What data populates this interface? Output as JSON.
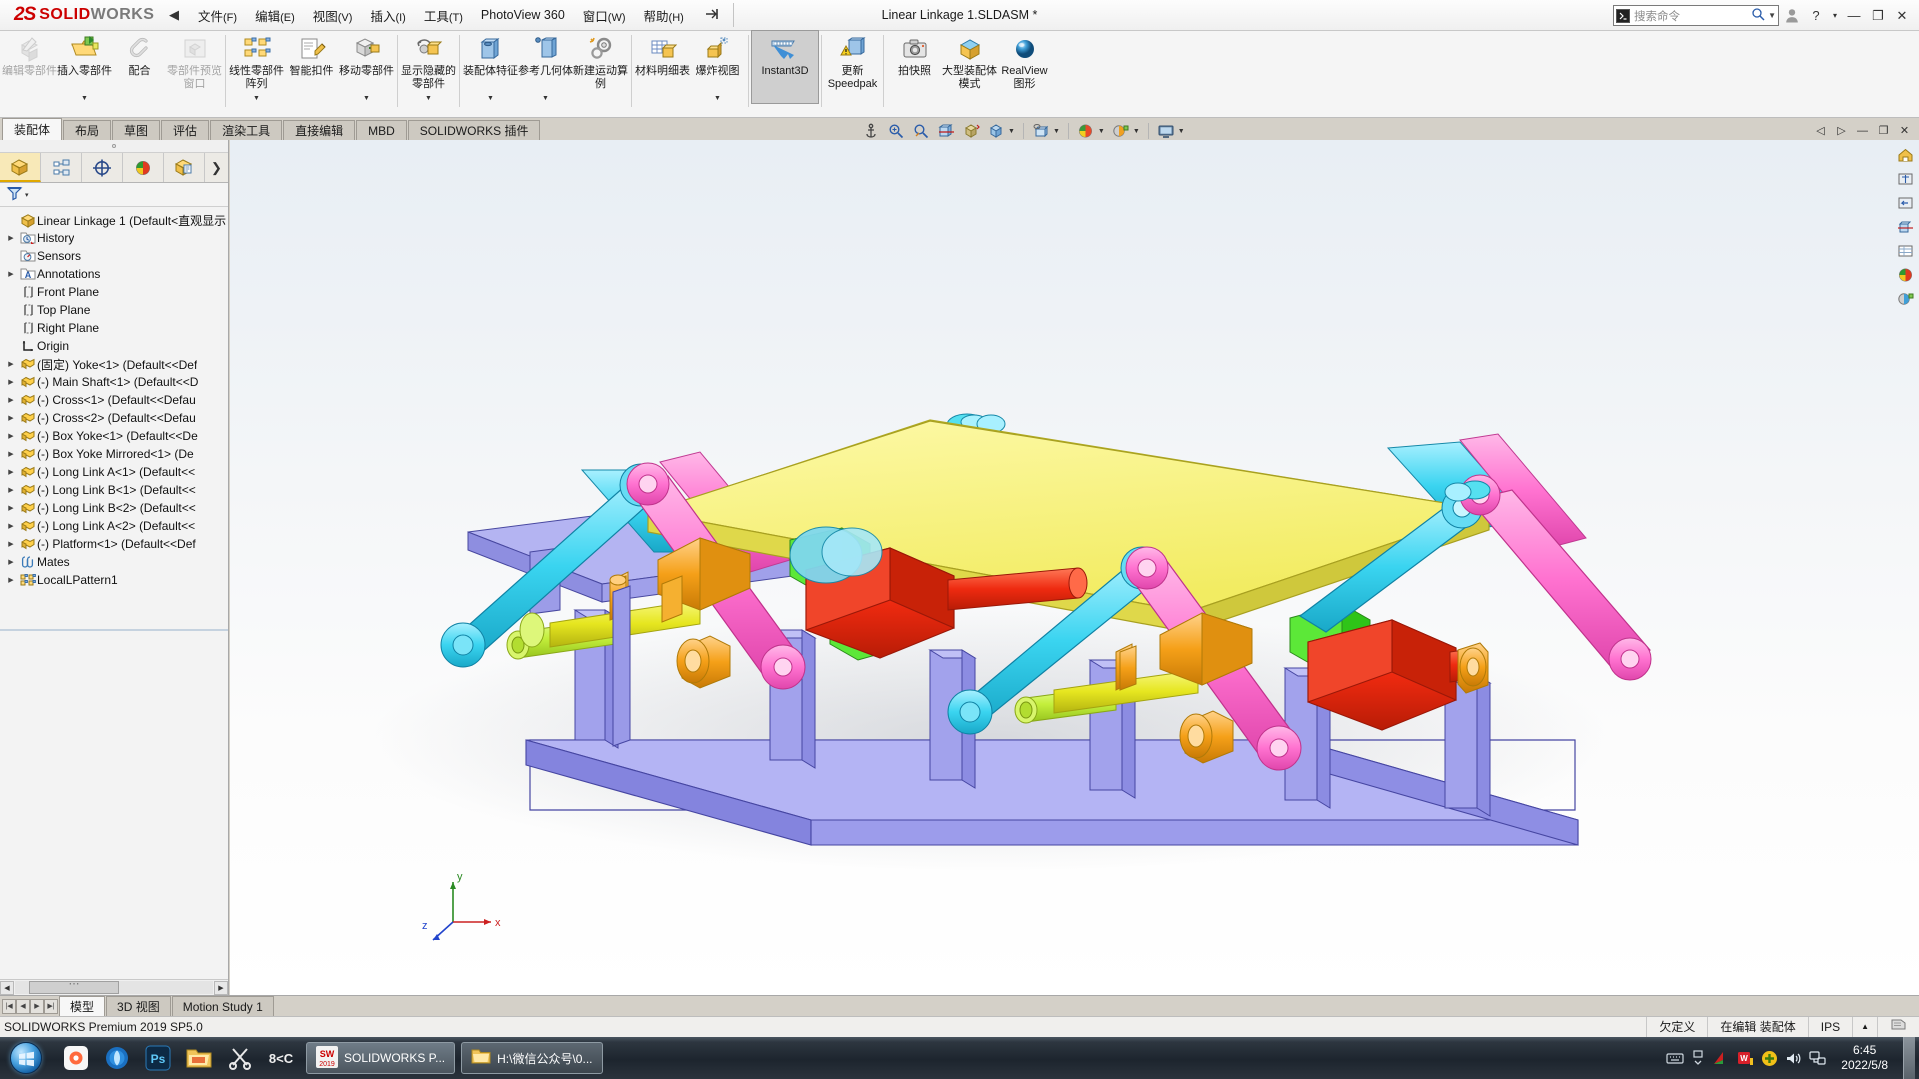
{
  "app": {
    "brand_ds": "2S",
    "brand_solid": "SOLID",
    "brand_works": "WORKS",
    "document_title": "Linear Linkage 1.SLDASM *",
    "version_text": "SOLIDWORKS Premium 2019 SP5.0"
  },
  "menu": {
    "collapse_glyph": "◀",
    "pin_glyph": "→|",
    "items": [
      {
        "label": "文件",
        "mnemonic": "(F)"
      },
      {
        "label": "编辑",
        "mnemonic": "(E)"
      },
      {
        "label": "视图",
        "mnemonic": "(V)"
      },
      {
        "label": "插入",
        "mnemonic": "(I)"
      },
      {
        "label": "工具",
        "mnemonic": "(T)"
      },
      {
        "label": "PhotoView 360",
        "mnemonic": ""
      },
      {
        "label": "窗口",
        "mnemonic": "(W)"
      },
      {
        "label": "帮助",
        "mnemonic": "(H)"
      }
    ]
  },
  "search": {
    "placeholder": "搜索命令",
    "command_glyph": "▶_"
  },
  "window_buttons": {
    "profile": "👤",
    "help": "?",
    "help_caret": "▾",
    "minimize": "—",
    "restore": "❐",
    "close": "✕"
  },
  "ribbon": {
    "buttons": [
      {
        "name": "edit-component",
        "label": "编辑零部件",
        "icon": "edit-component-icon",
        "disabled": true,
        "caret": false,
        "sep_after": false
      },
      {
        "name": "insert-components",
        "label": "插入零部件",
        "icon": "insert-components-icon",
        "disabled": false,
        "caret": true,
        "sep_after": false
      },
      {
        "name": "mate",
        "label": "配合",
        "icon": "mate-paperclip-icon",
        "disabled": false,
        "caret": false,
        "sep_after": false
      },
      {
        "name": "component-preview-window",
        "label": "零部件预览窗口",
        "icon": "component-preview-icon",
        "disabled": true,
        "caret": false,
        "sep_after": true
      },
      {
        "name": "linear-component-pattern",
        "label": "线性零部件阵列",
        "icon": "linear-pattern-icon",
        "disabled": false,
        "caret": true,
        "sep_after": false
      },
      {
        "name": "smart-fasteners",
        "label": "智能扣件",
        "icon": "smart-fastener-icon",
        "disabled": false,
        "caret": false,
        "sep_after": false
      },
      {
        "name": "move-component",
        "label": "移动零部件",
        "icon": "move-component-icon",
        "disabled": false,
        "caret": true,
        "sep_after": true
      },
      {
        "name": "show-hidden-components",
        "label": "显示隐藏的零部件",
        "icon": "show-hidden-icon",
        "disabled": false,
        "caret": true,
        "sep_after": true
      },
      {
        "name": "assembly-features",
        "label": "装配体特征",
        "icon": "assembly-feature-icon",
        "disabled": false,
        "caret": true,
        "sep_after": false
      },
      {
        "name": "reference-geometry",
        "label": "参考几何体",
        "icon": "reference-geometry-icon",
        "disabled": false,
        "caret": true,
        "sep_after": false
      },
      {
        "name": "new-motion-study",
        "label": "新建运动算例",
        "icon": "motion-study-icon",
        "disabled": false,
        "caret": false,
        "sep_after": true
      },
      {
        "name": "bill-of-materials",
        "label": "材料明细表",
        "icon": "bom-icon",
        "disabled": false,
        "caret": false,
        "sep_after": false
      },
      {
        "name": "exploded-view",
        "label": "爆炸视图",
        "icon": "exploded-view-icon",
        "disabled": false,
        "caret": true,
        "sep_after": true
      },
      {
        "name": "instant3d",
        "label": "Instant3D",
        "icon": "instant3d-icon",
        "disabled": false,
        "caret": false,
        "active": true,
        "sep_after": true
      },
      {
        "name": "update-speedpak",
        "label": "更新 Speedpak",
        "icon": "update-speedpak-icon",
        "disabled": false,
        "caret": false,
        "sep_after": true
      },
      {
        "name": "take-snapshot",
        "label": "拍快照",
        "icon": "camera-icon",
        "disabled": false,
        "caret": false,
        "sep_after": false
      },
      {
        "name": "large-assembly-mode",
        "label": "大型装配体模式",
        "icon": "large-assembly-icon",
        "disabled": false,
        "caret": false,
        "sep_after": false
      },
      {
        "name": "realview-graphics",
        "label": "RealView 图形",
        "icon": "realview-sphere-icon",
        "disabled": false,
        "caret": false,
        "sep_after": false
      }
    ]
  },
  "command_tabs": {
    "items": [
      "装配体",
      "布局",
      "草图",
      "评估",
      "渲染工具",
      "直接编辑",
      "MBD",
      "SOLIDWORKS 插件"
    ],
    "selected": "装配体"
  },
  "view_toolbar": {
    "buttons": [
      {
        "name": "zoom-to-fit-anchor",
        "icon": "anchor-icon",
        "caret": false
      },
      {
        "name": "zoom-to-area",
        "icon": "zoom-area-icon",
        "caret": false
      },
      {
        "name": "zoom-in-out",
        "icon": "zoom-inout-icon",
        "caret": false
      },
      {
        "name": "section-view",
        "icon": "section-view-icon",
        "caret": false
      },
      {
        "name": "view-orientation",
        "icon": "view-orientation-icon",
        "caret": false
      },
      {
        "name": "display-style",
        "icon": "display-style-cube-icon",
        "caret": true
      },
      {
        "name": "hide-show-items",
        "icon": "hide-show-icon",
        "caret": true
      },
      {
        "name": "edit-appearance",
        "icon": "appearance-sphere-icon",
        "caret": true
      },
      {
        "name": "apply-scene",
        "icon": "scene-icon",
        "caret": true
      },
      {
        "name": "view-settings",
        "icon": "view-settings-monitor-icon",
        "caret": true
      }
    ]
  },
  "doc_window_buttons": {
    "prev": "◁",
    "next": "▷",
    "minimize": "—",
    "restore": "❐",
    "close": "✕"
  },
  "left_panel": {
    "tabs": [
      {
        "name": "feature-manager-tree-tab",
        "icon": "assembly-tree-icon",
        "selected": true
      },
      {
        "name": "property-manager-tab",
        "icon": "property-manager-icon",
        "selected": false
      },
      {
        "name": "configuration-manager-tab",
        "icon": "configuration-icon",
        "selected": false
      },
      {
        "name": "display-manager-tab",
        "icon": "display-manager-palette-icon",
        "selected": false
      },
      {
        "name": "dimxpert-manager-tab",
        "icon": "dimxpert-icon",
        "selected": false
      }
    ],
    "tabs_more": "❯",
    "filter_icon": "filter-funnel-icon",
    "filter_caret": "▾",
    "tree": [
      {
        "label": "Linear Linkage 1  (Default<直观显示",
        "icon": "assembly-icon",
        "arrow": false,
        "indent": 0,
        "root": true
      },
      {
        "label": "History",
        "icon": "history-folder-icon",
        "arrow": true,
        "indent": 1
      },
      {
        "label": "Sensors",
        "icon": "sensors-folder-icon",
        "arrow": false,
        "indent": 1
      },
      {
        "label": "Annotations",
        "icon": "annotations-folder-icon",
        "arrow": true,
        "indent": 1
      },
      {
        "label": "Front Plane",
        "icon": "plane-icon",
        "arrow": false,
        "indent": 1
      },
      {
        "label": "Top Plane",
        "icon": "plane-icon",
        "arrow": false,
        "indent": 1
      },
      {
        "label": "Right Plane",
        "icon": "plane-icon",
        "arrow": false,
        "indent": 1
      },
      {
        "label": "Origin",
        "icon": "origin-icon",
        "arrow": false,
        "indent": 1
      },
      {
        "label": "(固定) Yoke<1> (Default<<Def",
        "icon": "part-icon",
        "arrow": true,
        "indent": 1
      },
      {
        "label": "(-) Main Shaft<1> (Default<<D",
        "icon": "part-icon",
        "arrow": true,
        "indent": 1
      },
      {
        "label": "(-) Cross<1> (Default<<Defau",
        "icon": "part-icon",
        "arrow": true,
        "indent": 1
      },
      {
        "label": "(-) Cross<2> (Default<<Defau",
        "icon": "part-icon",
        "arrow": true,
        "indent": 1
      },
      {
        "label": "(-) Box Yoke<1> (Default<<De",
        "icon": "part-icon",
        "arrow": true,
        "indent": 1
      },
      {
        "label": "(-) Box Yoke Mirrored<1> (De",
        "icon": "part-icon",
        "arrow": true,
        "indent": 1
      },
      {
        "label": "(-) Long Link A<1> (Default<<",
        "icon": "part-icon",
        "arrow": true,
        "indent": 1
      },
      {
        "label": "(-) Long Link B<1> (Default<<",
        "icon": "part-icon",
        "arrow": true,
        "indent": 1
      },
      {
        "label": "(-) Long Link B<2> (Default<<",
        "icon": "part-icon",
        "arrow": true,
        "indent": 1
      },
      {
        "label": "(-) Long Link A<2> (Default<<",
        "icon": "part-icon",
        "arrow": true,
        "indent": 1
      },
      {
        "label": "(-) Platform<1> (Default<<Def",
        "icon": "part-icon",
        "arrow": true,
        "indent": 1
      },
      {
        "label": "Mates",
        "icon": "mates-icon",
        "arrow": true,
        "indent": 1
      },
      {
        "label": "LocalLPattern1",
        "icon": "local-pattern-icon",
        "arrow": true,
        "indent": 1
      }
    ],
    "hscroll": {
      "left_arrow": "◀",
      "right_arrow": "▶"
    }
  },
  "right_tools": [
    {
      "name": "view-orientation-home-icon"
    },
    {
      "name": "zoom-to-fit-icon"
    },
    {
      "name": "previous-view-icon"
    },
    {
      "name": "section-view-tool-icon"
    },
    {
      "name": "display-state-icon"
    },
    {
      "name": "appearances-icon"
    },
    {
      "name": "scenes-icon"
    }
  ],
  "triad": {
    "x": "x",
    "y": "y",
    "z": "z"
  },
  "bottom_tabs": {
    "nav": [
      "|◀",
      "◀",
      "▶",
      "▶|"
    ],
    "items": [
      "模型",
      "3D 视图",
      "Motion Study 1"
    ],
    "selected": "模型"
  },
  "status_bar": {
    "left": "SOLIDWORKS Premium 2019 SP5.0",
    "cells": [
      "欠定义",
      "在编辑 装配体",
      "IPS"
    ],
    "arrow": "▲",
    "doc_icon": "document-properties-icon"
  },
  "taskbar": {
    "start": "windows-start-orb",
    "quick_items": [
      {
        "name": "taskbar-app-xmind",
        "glyph": "◈",
        "color": "#ff6a3d"
      },
      {
        "name": "taskbar-app-browser",
        "glyph": "◉",
        "color": "#2196f3"
      },
      {
        "name": "taskbar-app-photoshop",
        "glyph": "Ps",
        "color": "#1d3f5e"
      },
      {
        "name": "taskbar-app-explorer",
        "glyph": "🗂",
        "color": "#f0c060"
      },
      {
        "name": "taskbar-app-snipaste",
        "glyph": "✂",
        "color": "#dddddd"
      },
      {
        "name": "taskbar-app-editor",
        "glyph": "8<",
        "color": "#e8e8e8"
      }
    ],
    "windows": [
      {
        "name": "taskwin-solidworks",
        "label": "SOLIDWORKS P...",
        "icon_text": "SW",
        "year": "2019"
      },
      {
        "name": "taskwin-folder",
        "label": "H:\\微信公众号\\0...",
        "icon_text": "📁",
        "year": ""
      }
    ],
    "tray": [
      {
        "name": "tray-keyboard-icon",
        "glyph": "⌨"
      },
      {
        "name": "tray-overflow-icon",
        "glyph": "⧉"
      },
      {
        "name": "tray-flag-icon",
        "glyph": "◣"
      },
      {
        "name": "tray-wps-icon",
        "glyph": "W"
      },
      {
        "name": "tray-shield-icon",
        "glyph": "✛"
      },
      {
        "name": "tray-volume-icon",
        "glyph": "🔊"
      },
      {
        "name": "tray-network-icon",
        "glyph": "🖧"
      }
    ],
    "clock_time": "6:45",
    "clock_date": "2022/5/8"
  },
  "colors": {
    "brand_red": "#cc0000",
    "accent_blue": "#2a5caa",
    "platform_yellow": "#f5ef7a",
    "base_purple": "#9a9aee",
    "link_pink": "#ff7fd4",
    "link_cyan": "#38d8f0",
    "link_green": "#c6f03c",
    "shaft_yellow": "#e8e832",
    "cross_red": "#ee2211",
    "yoke_orange": "#f5a623"
  }
}
